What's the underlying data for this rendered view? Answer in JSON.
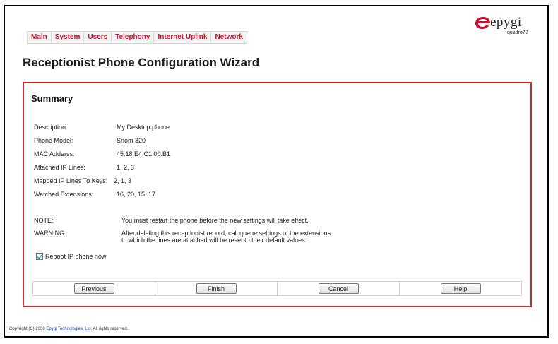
{
  "nav": {
    "items": [
      "Main",
      "System",
      "Users",
      "Telephony",
      "Internet Uplink",
      "Network"
    ]
  },
  "brand": {
    "logo_text": "epygi",
    "model": "quadro72",
    "accent": "#c8102e"
  },
  "page": {
    "title": "Receptionist Phone Configuration Wizard"
  },
  "summary": {
    "heading": "Summary",
    "fields": [
      {
        "label": "Description:",
        "value": "My Desktop phone"
      },
      {
        "label": "Phone Model:",
        "value": "Snom 320"
      },
      {
        "label": "MAC Adderss:",
        "value": "45:18:E4:C1:00:B1"
      },
      {
        "label": "Attached IP Lines:",
        "value": "1, 2, 3"
      },
      {
        "label": "Mapped IP Lines To Keys:",
        "value": "2, 1, 3"
      },
      {
        "label": "Watched Extensions:",
        "value": "16, 20, 15, 17"
      }
    ],
    "note_label": "NOTE:",
    "note_text": "You must restart the phone before the new settings will take effect.",
    "warning_label": "WARNING:",
    "warning_line1": "After deleting this receptionist record, call queue settings of the extensions",
    "warning_line2": "to which the lines are attached will be reset to their default values.",
    "reboot_label": "Reboot IP phone now",
    "reboot_checked": true
  },
  "buttons": {
    "previous": "Previous",
    "finish": "Finish",
    "cancel": "Cancel",
    "help": "Help"
  },
  "footer": {
    "prefix": "Copyright (C) 2008 ",
    "link": "Epygi Technologies, Ltd.",
    "suffix": " All rights reserved."
  },
  "colors": {
    "panel_border": "#cc2e35",
    "nav_text": "#c8102e"
  }
}
